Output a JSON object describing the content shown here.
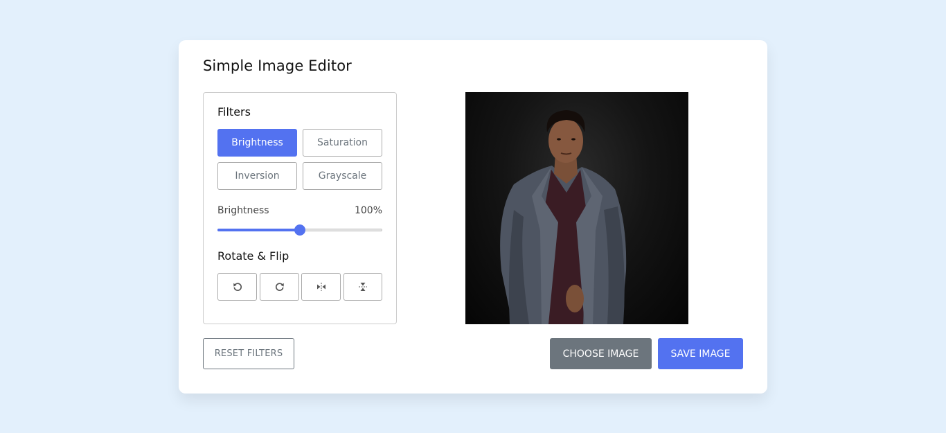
{
  "app": {
    "title": "Simple Image Editor"
  },
  "filters": {
    "heading": "Filters",
    "buttons": [
      {
        "label": "Brightness",
        "active": true
      },
      {
        "label": "Saturation",
        "active": false
      },
      {
        "label": "Inversion",
        "active": false
      },
      {
        "label": "Grayscale",
        "active": false
      }
    ],
    "slider": {
      "name": "Brightness",
      "value_text": "100%",
      "value": 100,
      "max": 200
    }
  },
  "rotate": {
    "heading": "Rotate & Flip",
    "buttons": [
      {
        "icon": "rotate-left-icon"
      },
      {
        "icon": "rotate-right-icon"
      },
      {
        "icon": "flip-horizontal-icon"
      },
      {
        "icon": "flip-vertical-icon"
      }
    ]
  },
  "actions": {
    "reset_label": "RESET FILTERS",
    "choose_label": "CHOOSE IMAGE",
    "save_label": "SAVE IMAGE"
  },
  "colors": {
    "accent": "#5372f0",
    "secondary": "#6c757d",
    "background": "#e3f0fc"
  }
}
